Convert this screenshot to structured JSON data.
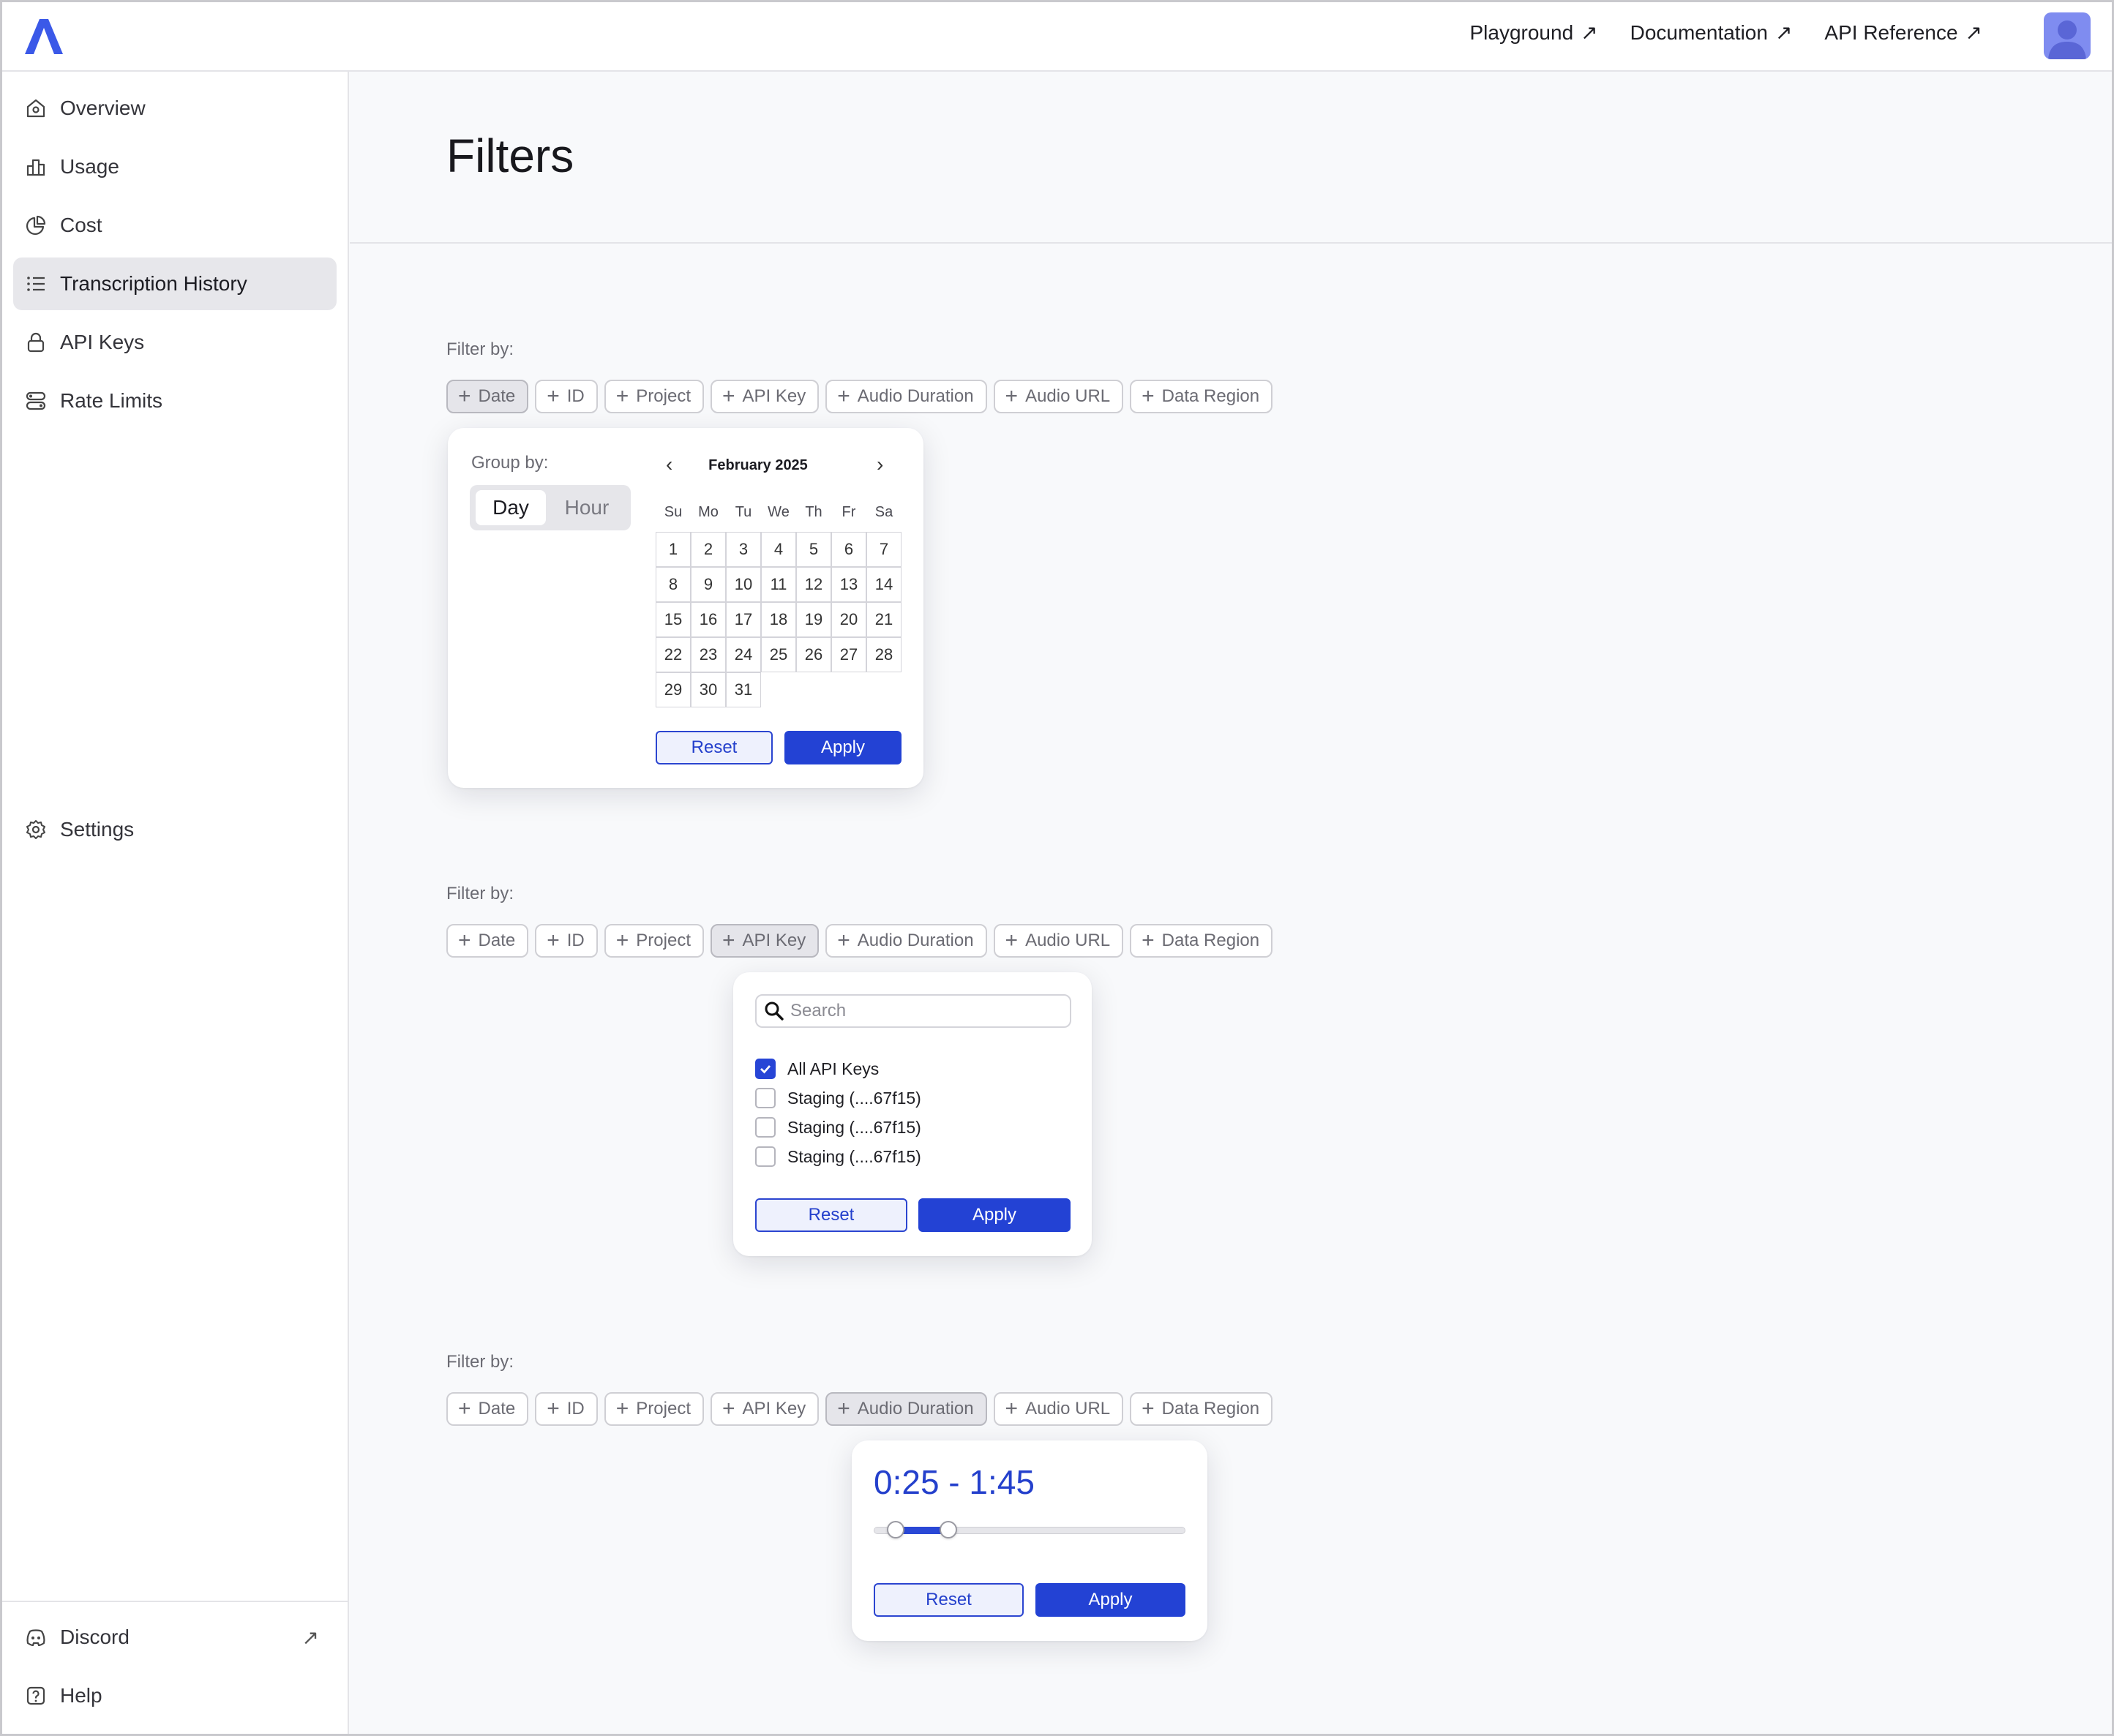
{
  "topbar": {
    "links": [
      {
        "label": "Playground",
        "icon": "external-link-icon",
        "arrow": "↗"
      },
      {
        "label": "Documentation",
        "icon": "external-link-icon",
        "arrow": "↗"
      },
      {
        "label": "API Reference",
        "icon": "external-link-icon",
        "arrow": "↗"
      }
    ],
    "colors": {
      "logo": "#3b59e8",
      "avatar": "#7f8cf0"
    }
  },
  "sidebar": {
    "items": [
      {
        "label": "Overview",
        "icon": "home-icon"
      },
      {
        "label": "Usage",
        "icon": "bar-chart-icon"
      },
      {
        "label": "Cost",
        "icon": "pie-chart-icon"
      },
      {
        "label": "Transcription History",
        "icon": "list-icon",
        "active": true
      },
      {
        "label": "API Keys",
        "icon": "lock-icon"
      },
      {
        "label": "Rate Limits",
        "icon": "toggles-icon"
      }
    ],
    "bottom": [
      {
        "label": "Settings",
        "icon": "gear-icon"
      },
      {
        "label": "Discord",
        "icon": "discord-icon",
        "arrow": "↗"
      },
      {
        "label": "Help",
        "icon": "help-icon"
      }
    ]
  },
  "main": {
    "title": "Filters",
    "filter_label": "Filter by:",
    "chips": [
      "Date",
      "ID",
      "Project",
      "API Key",
      "Audio Duration",
      "Audio URL",
      "Data Region"
    ],
    "chip_plus": "+",
    "sections": [
      {
        "active_chip": "Date"
      },
      {
        "active_chip": "API Key"
      },
      {
        "active_chip": "Audio Duration"
      }
    ]
  },
  "date_popover": {
    "group_by_label": "Group by:",
    "options": [
      "Day",
      "Hour"
    ],
    "selected": "Day",
    "month": "February 2025",
    "prev": "‹",
    "next": "›",
    "weekdays": [
      "Su",
      "Mo",
      "Tu",
      "We",
      "Th",
      "Fr",
      "Sa"
    ],
    "days": [
      "1",
      "2",
      "3",
      "4",
      "5",
      "6",
      "7",
      "8",
      "9",
      "10",
      "11",
      "12",
      "13",
      "14",
      "15",
      "16",
      "17",
      "18",
      "19",
      "20",
      "21",
      "22",
      "23",
      "24",
      "25",
      "26",
      "27",
      "28",
      "29",
      "30",
      "31"
    ],
    "reset": "Reset",
    "apply": "Apply"
  },
  "api_key_popover": {
    "search_placeholder": "Search",
    "search_value": "",
    "options": [
      {
        "label": "All API Keys",
        "checked": true
      },
      {
        "label": "Staging (....67f15)",
        "checked": false
      },
      {
        "label": "Staging (....67f15)",
        "checked": false
      },
      {
        "label": "Staging (....67f15)",
        "checked": false
      }
    ],
    "reset": "Reset",
    "apply": "Apply"
  },
  "duration_popover": {
    "range_text": "0:25 - 1:45",
    "slider": {
      "min_fraction": 0.07,
      "max_fraction": 0.24
    },
    "reset": "Reset",
    "apply": "Apply"
  }
}
